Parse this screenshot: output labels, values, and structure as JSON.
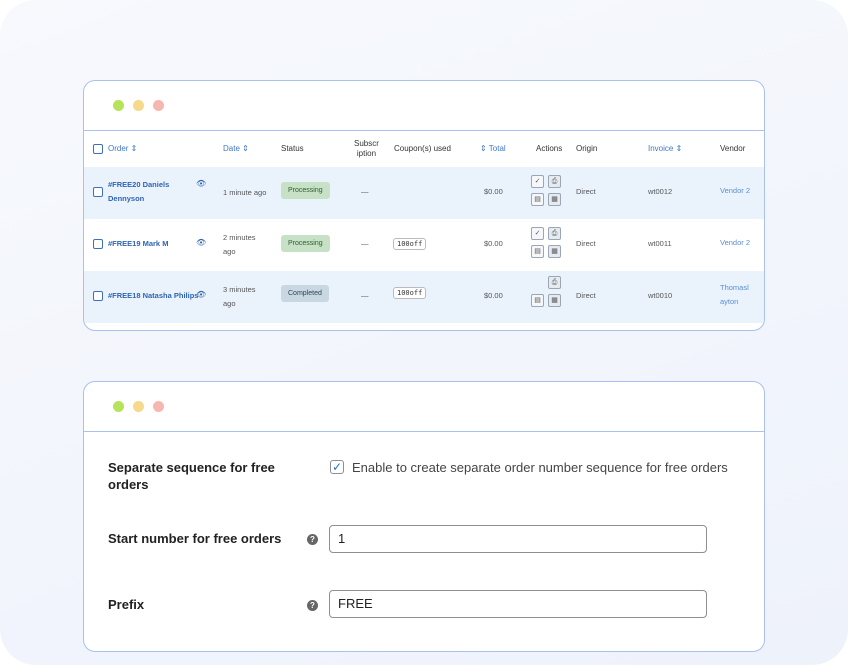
{
  "table": {
    "headers": {
      "order": "Order ⇕",
      "date": "Date ⇕",
      "status": "Status",
      "subscription_line1": "Subscr",
      "subscription_line2": "iption",
      "coupons": "Coupon(s) used",
      "total": "⇕ Total",
      "actions": "Actions",
      "origin": "Origin",
      "invoice": "Invoice ⇕",
      "vendor": "Vendor"
    },
    "rows": [
      {
        "order_line1": "#FREE20 Daniels",
        "order_line2": "Dennyson",
        "date_line1": "1 minute ago",
        "date_line2": "",
        "status": "Processing",
        "subscription": "—",
        "coupon": "",
        "total": "$0.00",
        "origin": "Direct",
        "invoice": "wt0012",
        "vendor_line1": "Vendor 2",
        "vendor_line2": ""
      },
      {
        "order_line1": "#FREE19 Mark M",
        "order_line2": "",
        "date_line1": "2 minutes",
        "date_line2": "ago",
        "status": "Processing",
        "subscription": "—",
        "coupon": "100off",
        "total": "$0.00",
        "origin": "Direct",
        "invoice": "wt0011",
        "vendor_line1": "Vendor 2",
        "vendor_line2": ""
      },
      {
        "order_line1": "#FREE18 Natasha Philips",
        "order_line2": "",
        "date_line1": "3 minutes",
        "date_line2": "ago",
        "status": "Completed",
        "subscription": "—",
        "coupon": "100off",
        "total": "$0.00",
        "origin": "Direct",
        "invoice": "wt0010",
        "vendor_line1": "Thomasl",
        "vendor_line2": "ayton"
      }
    ]
  },
  "form": {
    "separate_label_line1": "Separate sequence for free",
    "separate_label_line2": "orders",
    "separate_checkbox_checked": true,
    "separate_checkbox_text": "Enable to create separate order number sequence for free orders",
    "start_label": "Start number for free orders",
    "start_value": "1",
    "prefix_label": "Prefix",
    "prefix_value": "FREE"
  },
  "colors": {
    "window_border": "#a9c1ec",
    "link_blue": "#2f64b3",
    "processing_bg": "#c6e1c6",
    "completed_bg": "#c8d7e1",
    "dot_green": "#b6e35a",
    "dot_yellow": "#f6d98a",
    "dot_red": "#f7b7ae"
  }
}
